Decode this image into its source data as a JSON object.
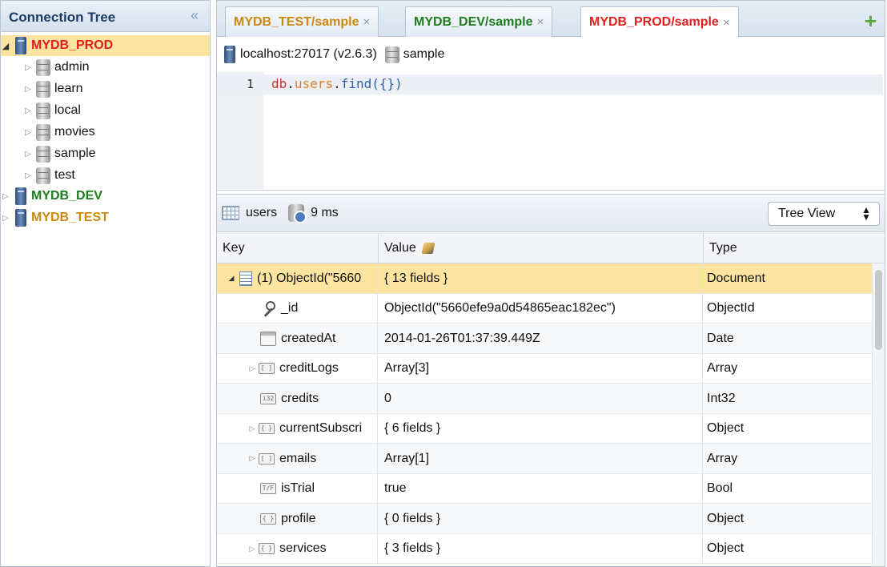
{
  "sidebar": {
    "title": "Connection Tree",
    "collapse_icon": "double-chevron-left-icon",
    "servers": [
      {
        "name": "MYDB_PROD",
        "color": "#e02020",
        "expanded": true,
        "databases": [
          "admin",
          "learn",
          "local",
          "movies",
          "sample",
          "test"
        ]
      },
      {
        "name": "MYDB_DEV",
        "color": "#1e7d1e",
        "expanded": false
      },
      {
        "name": "MYDB_TEST",
        "color": "#c98a0e",
        "expanded": false
      }
    ]
  },
  "tabs": [
    {
      "label": "MYDB_TEST/sample",
      "color": "#c98a0e",
      "close": "×"
    },
    {
      "label": "MYDB_DEV/sample",
      "color": "#1e7d1e",
      "close": "×"
    },
    {
      "label": "MYDB_PROD/sample",
      "color": "#e02020",
      "close": "×",
      "active": true
    }
  ],
  "add_tab_icon": "+",
  "connection": {
    "host": "localhost:27017 (v2.6.3)",
    "database": "sample"
  },
  "editor": {
    "line_number": "1",
    "code_db": "db",
    "code_dot1": ".",
    "code_coll": "users",
    "code_dot2": ".",
    "code_call": "find({})"
  },
  "result": {
    "collection": "users",
    "time": "9 ms",
    "view_mode": "Tree View"
  },
  "grid": {
    "columns": [
      "Key",
      "Value",
      "Type"
    ],
    "rows": [
      {
        "key": "(1) ObjectId(\"5660",
        "value": "{ 13 fields }",
        "type": "Document",
        "icon": "document-icon",
        "expand": "open"
      },
      {
        "key": "_id",
        "value": "ObjectId(\"5660efe9a0d54865eac182ec\")",
        "type": "ObjectId",
        "icon": "key-icon"
      },
      {
        "key": "createdAt",
        "value": "2014-01-26T01:37:39.449Z",
        "type": "Date",
        "icon": "calendar-icon"
      },
      {
        "key": "creditLogs",
        "value": "Array[3]",
        "type": "Array",
        "icon": "array-icon",
        "expand": "closed"
      },
      {
        "key": "credits",
        "value": "0",
        "type": "Int32",
        "icon": "int32-icon"
      },
      {
        "key": "currentSubscri",
        "value": "{ 6 fields }",
        "type": "Object",
        "icon": "object-icon",
        "expand": "closed"
      },
      {
        "key": "emails",
        "value": "Array[1]",
        "type": "Array",
        "icon": "array-icon",
        "expand": "closed"
      },
      {
        "key": "isTrial",
        "value": "true",
        "type": "Bool",
        "icon": "bool-icon"
      },
      {
        "key": "profile",
        "value": "{ 0 fields }",
        "type": "Object",
        "icon": "object-icon"
      },
      {
        "key": "services",
        "value": "{ 3 fields }",
        "type": "Object",
        "icon": "object-icon",
        "expand": "closed"
      }
    ]
  }
}
